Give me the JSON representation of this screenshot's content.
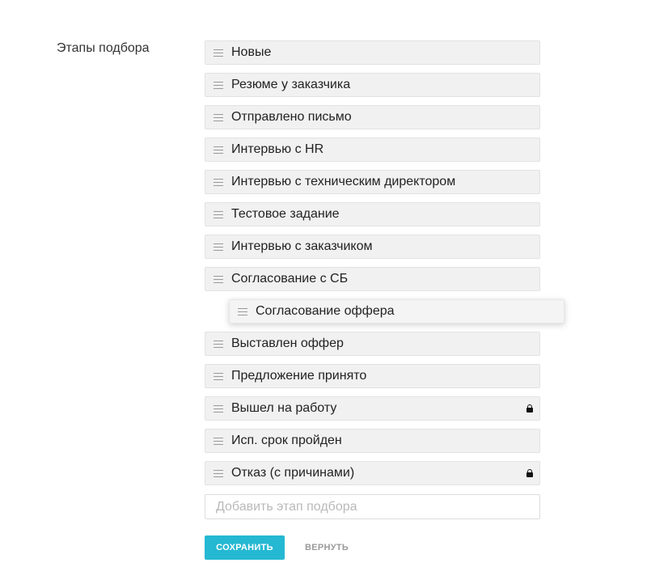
{
  "form": {
    "label": "Этапы подбора"
  },
  "stages": [
    {
      "label": "Новые",
      "locked": false
    },
    {
      "label": "Резюме у заказчика",
      "locked": false
    },
    {
      "label": "Отправлено письмо",
      "locked": false
    },
    {
      "label": "Интервью с HR",
      "locked": false
    },
    {
      "label": "Интервью с техническим директором",
      "locked": false
    },
    {
      "label": "Тестовое задание",
      "locked": false
    },
    {
      "label": "Интервью с заказчиком",
      "locked": false
    },
    {
      "label": "Согласование с СБ",
      "locked": false
    },
    {
      "label": "Согласование оффера",
      "locked": false,
      "dragging": true
    },
    {
      "label": "Выставлен оффер",
      "locked": false
    },
    {
      "label": "Предложение принято",
      "locked": false
    },
    {
      "label": "Вышел на работу",
      "locked": true
    },
    {
      "label": "Исп. срок пройден",
      "locked": false
    },
    {
      "label": "Отказ (с причинами)",
      "locked": true
    }
  ],
  "add_stage": {
    "placeholder": "Добавить этап подбора",
    "value": ""
  },
  "actions": {
    "save_label": "СОХРАНИТЬ",
    "revert_label": "ВЕРНУТЬ"
  },
  "icons": {
    "drag": "drag-handle-icon",
    "lock": "lock-icon"
  },
  "colors": {
    "accent": "#25b8d2",
    "row_background": "#f1f1f1",
    "secondary_text": "#9a9a9a"
  }
}
